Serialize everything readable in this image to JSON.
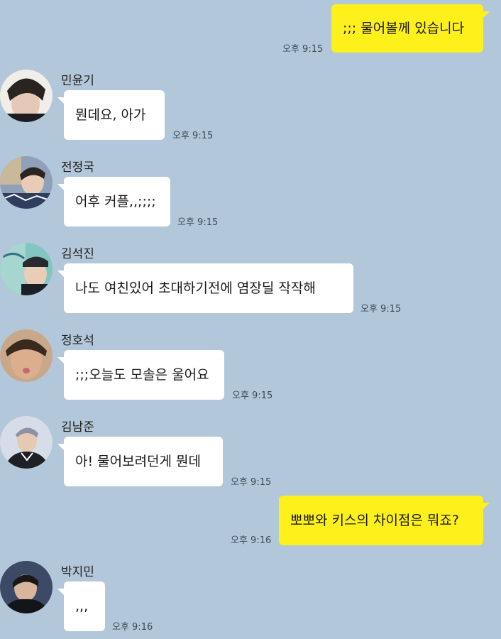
{
  "colors": {
    "background": "#b2c7d9",
    "bubble_mine": "#fef01b",
    "bubble_other": "#ffffff"
  },
  "messages": [
    {
      "text": ";;; 물어볼께 있습니다",
      "time": "오후 9:15"
    },
    {
      "sender": "민윤기",
      "text": "뭔데요, 아가",
      "time": "오후 9:15"
    },
    {
      "sender": "전정국",
      "text": "어후 커플,,;;;;",
      "time": "오후 9:15"
    },
    {
      "sender": "김석진",
      "text": "나도 여친있어 초대하기전에 염장딜 작작해",
      "time": "오후 9:15"
    },
    {
      "sender": "정호석",
      "text": ";;;오늘도 모솔은 울어요",
      "time": "오후 9:15"
    },
    {
      "sender": "김남준",
      "text": "아! 물어보려던게 뭔데",
      "time": "오후 9:15"
    },
    {
      "text": "뽀뽀와 키스의 차이점은 뭐죠?",
      "time": "오후 9:16"
    },
    {
      "sender": "박지민",
      "text": ",,,",
      "time": "오후 9:16"
    }
  ]
}
